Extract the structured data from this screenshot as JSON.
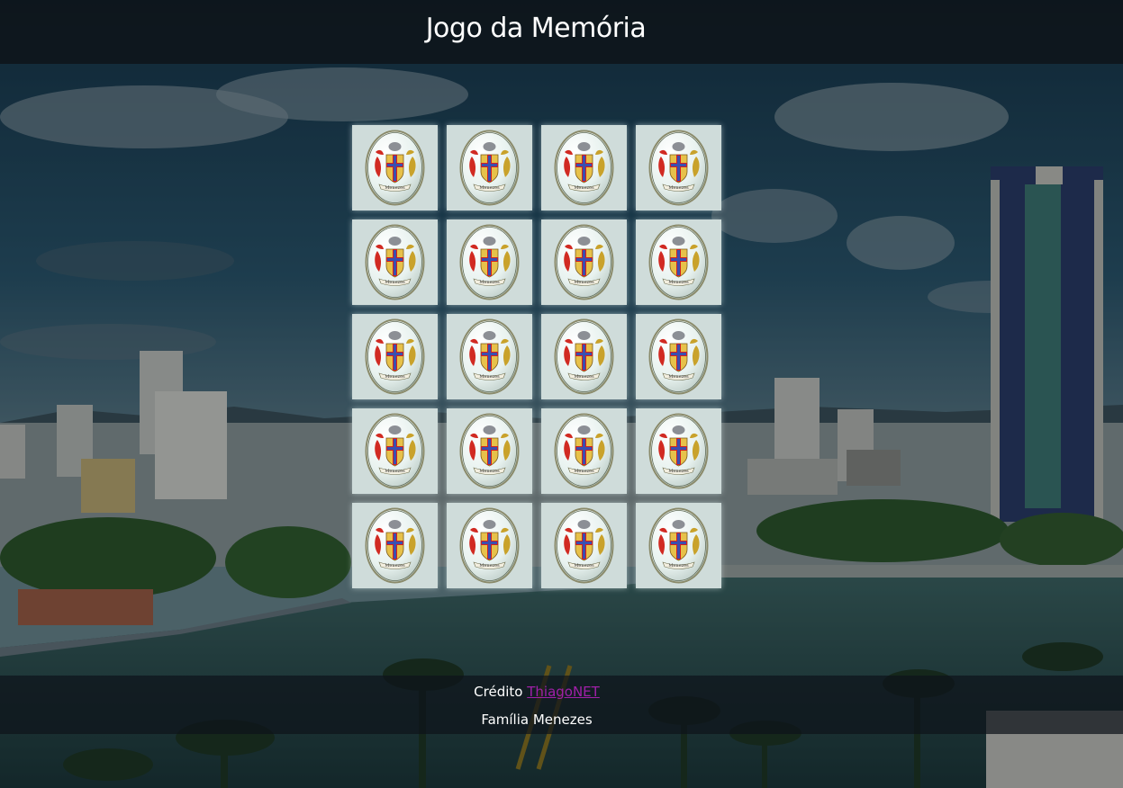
{
  "header": {
    "title": "Jogo da Memória"
  },
  "board": {
    "rows": 5,
    "columns": 4,
    "card_back": {
      "icon": "menezes-coat-of-arms-icon",
      "motto_text": "Menezes"
    }
  },
  "footer": {
    "credit_label": "Crédito",
    "credit_link": "ThiagoNET",
    "family": "Família Menezes"
  },
  "colors": {
    "header_bg": "#0e141a",
    "card_bg": "#cfdcda",
    "link": "#a020a8",
    "text": "#ffffff"
  }
}
